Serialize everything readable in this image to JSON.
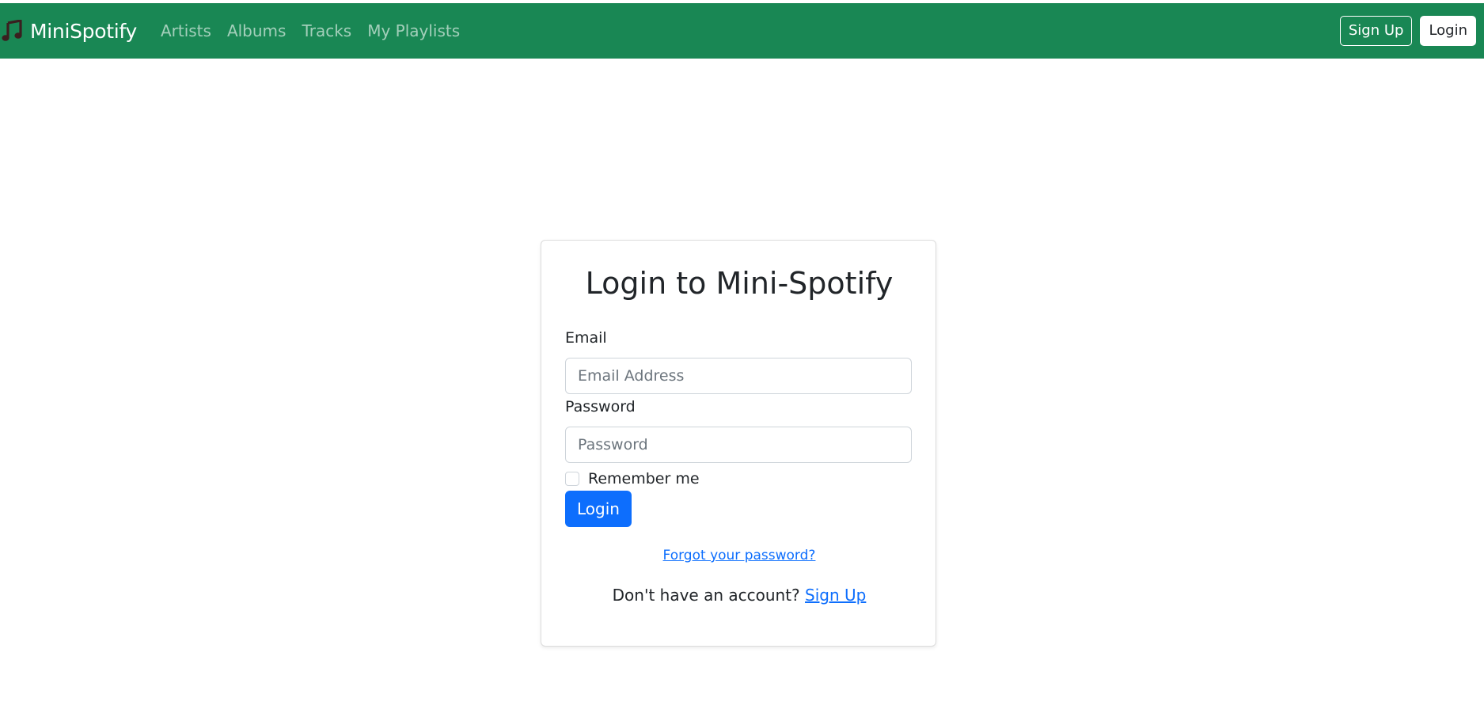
{
  "navbar": {
    "brand": "MiniSpotify",
    "brand_icon": "music-note-icon",
    "links": [
      "Artists",
      "Albums",
      "Tracks",
      "My Playlists"
    ],
    "signup_label": "Sign Up",
    "login_label": "Login",
    "background_color": "#198754"
  },
  "login_card": {
    "title": "Login to Mini-Spotify",
    "email_label": "Email",
    "email_placeholder": "Email Address",
    "email_value": "",
    "password_label": "Password",
    "password_placeholder": "Password",
    "password_value": "",
    "remember_label": "Remember me",
    "remember_checked": false,
    "submit_label": "Login",
    "forgot_link": "Forgot your password?",
    "no_account_text": "Don't have an account?",
    "signup_link": "Sign Up"
  },
  "colors": {
    "primary": "#0d6efd",
    "brand_green": "#198754"
  }
}
